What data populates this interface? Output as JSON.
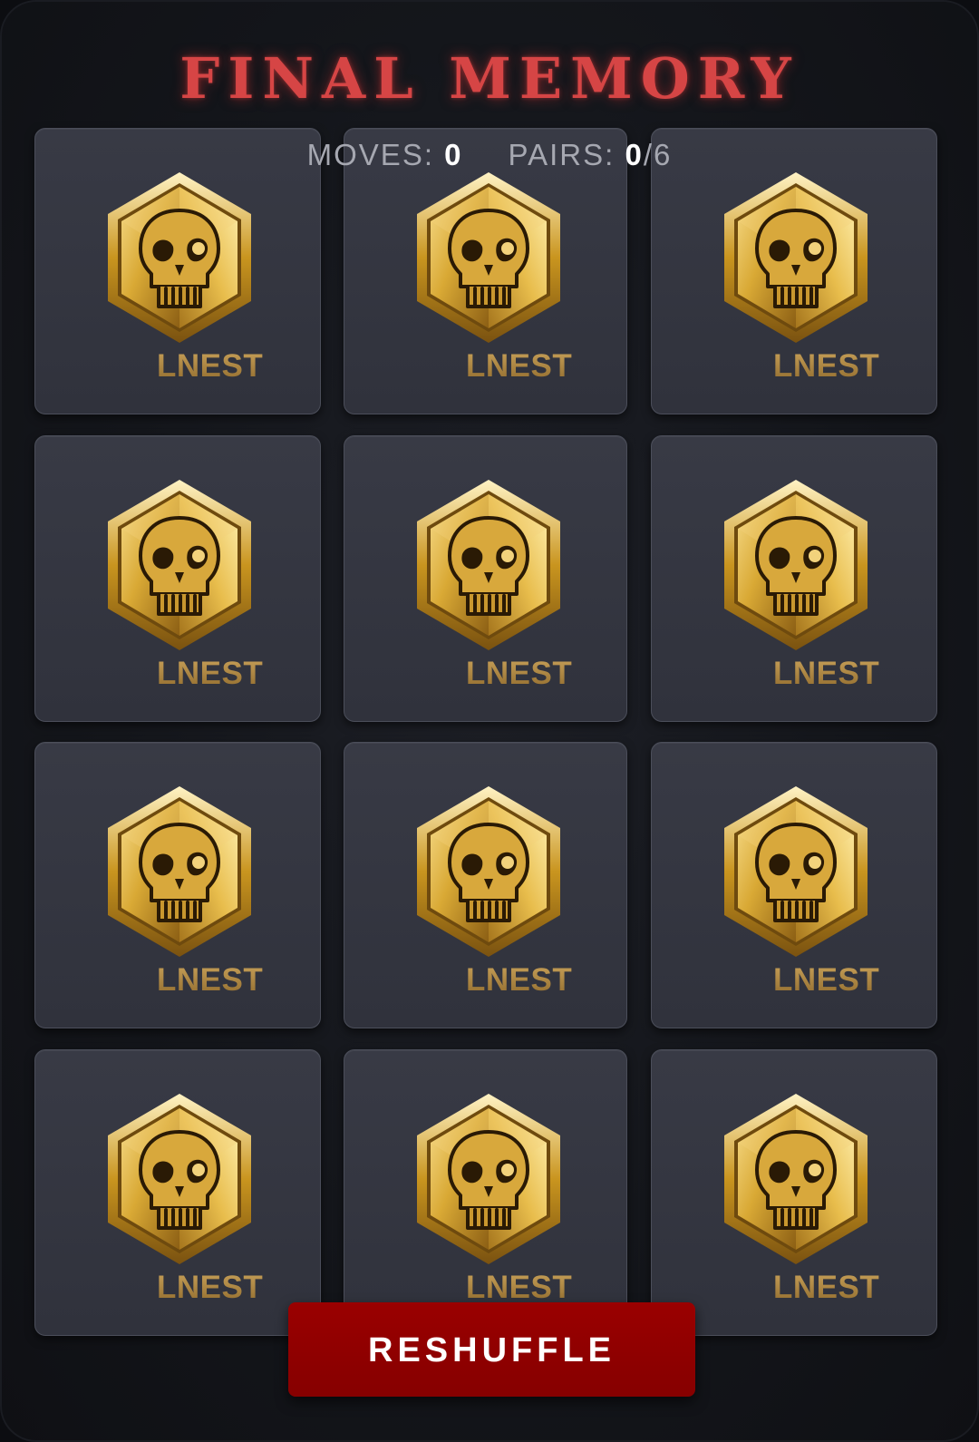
{
  "game": {
    "title": "FINAL MEMORY",
    "stats": {
      "moves_label": "MOVES:",
      "moves_value": "0",
      "pairs_label": "PAIRS:",
      "pairs_value": "0",
      "pairs_total": "/6"
    },
    "reshuffle_label": "RESHUFFLE"
  },
  "cards": [
    {
      "state": "face-down",
      "icon": "gold-skull-hexagon-icon",
      "brand": "LNEST"
    },
    {
      "state": "face-down",
      "icon": "gold-skull-hexagon-icon",
      "brand": "LNEST"
    },
    {
      "state": "face-down",
      "icon": "gold-skull-hexagon-icon",
      "brand": "LNEST"
    },
    {
      "state": "face-down",
      "icon": "gold-skull-hexagon-icon",
      "brand": "LNEST"
    },
    {
      "state": "face-down",
      "icon": "gold-skull-hexagon-icon",
      "brand": "LNEST"
    },
    {
      "state": "face-down",
      "icon": "gold-skull-hexagon-icon",
      "brand": "LNEST"
    },
    {
      "state": "face-down",
      "icon": "gold-skull-hexagon-icon",
      "brand": "LNEST"
    },
    {
      "state": "face-down",
      "icon": "gold-skull-hexagon-icon",
      "brand": "LNEST"
    },
    {
      "state": "face-down",
      "icon": "gold-skull-hexagon-icon",
      "brand": "LNEST"
    },
    {
      "state": "face-down",
      "icon": "gold-skull-hexagon-icon",
      "brand": "LNEST"
    },
    {
      "state": "face-down",
      "icon": "gold-skull-hexagon-icon",
      "brand": "LNEST"
    },
    {
      "state": "face-down",
      "icon": "gold-skull-hexagon-icon",
      "brand": "LNEST"
    }
  ],
  "colors": {
    "background": "#14161b",
    "title_red": "#d64545",
    "card_face": "#363842",
    "card_border": "#4b4e5a",
    "gold": "#c9a25a",
    "button_red": "#8f0000",
    "stat_label": "#a6a8b1",
    "stat_value": "#ffffff"
  }
}
